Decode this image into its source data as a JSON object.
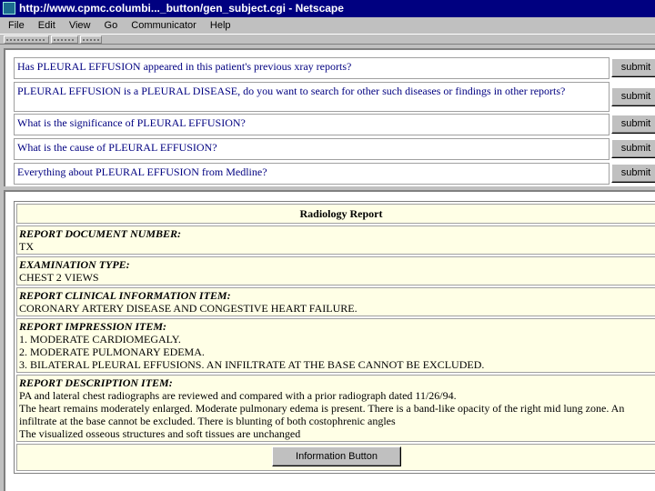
{
  "window": {
    "title": "http://www.cpmc.columbi..._button/gen_subject.cgi - Netscape"
  },
  "menu": [
    "File",
    "Edit",
    "View",
    "Go",
    "Communicator",
    "Help"
  ],
  "questions": [
    {
      "text": "Has PLEURAL EFFUSION appeared in this patient's previous xray reports?",
      "button": "submit"
    },
    {
      "text": "PLEURAL EFFUSION is a PLEURAL DISEASE, do you want to search for other such diseases or findings in other reports?",
      "button": "submit"
    },
    {
      "text": "What is the significance of PLEURAL EFFUSION?",
      "button": "submit"
    },
    {
      "text": "What is the cause of PLEURAL EFFUSION?",
      "button": "submit"
    },
    {
      "text": "Everything about PLEURAL EFFUSION from Medline?",
      "button": "submit"
    }
  ],
  "report": {
    "title": "Radiology Report",
    "document_number_label": "REPORT DOCUMENT NUMBER:",
    "document_number": "TX",
    "exam_type_label": "EXAMINATION TYPE:",
    "exam_type": "CHEST 2 VIEWS",
    "clinical_label": "REPORT CLINICAL INFORMATION ITEM:",
    "clinical": "CORONARY ARTERY DISEASE AND CONGESTIVE HEART FAILURE.",
    "impression_label": "REPORT IMPRESSION ITEM:",
    "impression": [
      "1. MODERATE CARDIOMEGALY.",
      "2. MODERATE PULMONARY EDEMA.",
      "3. BILATERAL PLEURAL EFFUSIONS. AN INFILTRATE AT THE BASE CANNOT BE EXCLUDED."
    ],
    "description_label": "REPORT DESCRIPTION ITEM:",
    "description": [
      "PA and lateral chest radiographs are reviewed and compared with a prior radiograph dated 11/26/94.",
      "The heart remains moderately enlarged. Moderate pulmonary edema is present. There is a band-like opacity of the right mid lung zone. An",
      "infiltrate at the base cannot be excluded. There is blunting of both costophrenic angles",
      "The visualized osseous structures and soft tissues are unchanged"
    ],
    "info_button": "Information Button"
  }
}
